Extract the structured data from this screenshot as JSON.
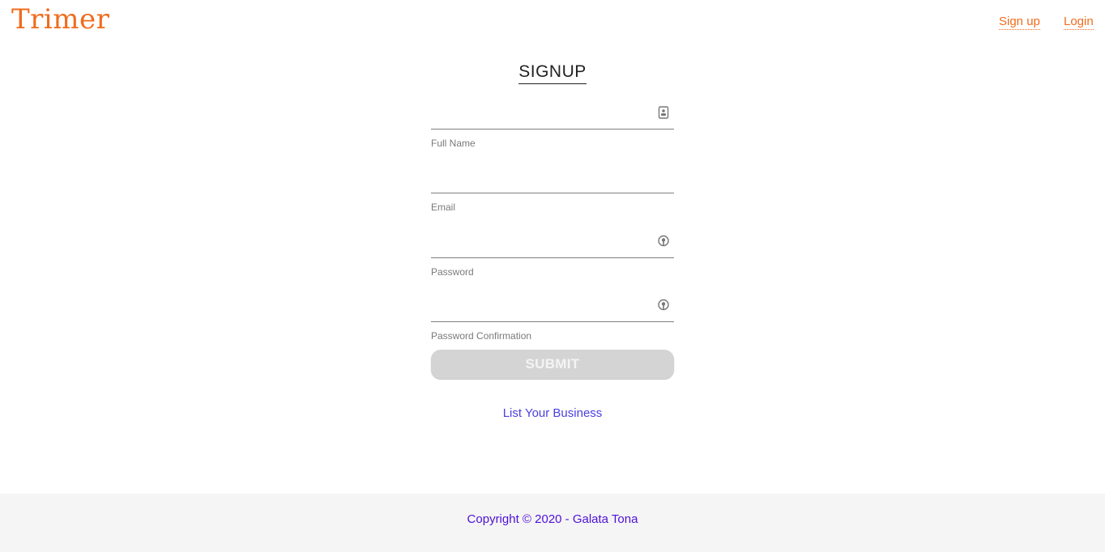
{
  "header": {
    "logo_text": "Trimer",
    "nav": {
      "signup": "Sign up",
      "login": "Login"
    }
  },
  "form": {
    "title": "SIGNUP",
    "fields": [
      {
        "label": "Full Name",
        "value": "",
        "icon": "contact-card-icon"
      },
      {
        "label": "Email",
        "value": "",
        "icon": null
      },
      {
        "label": "Password",
        "value": "",
        "icon": "lock-icon"
      },
      {
        "label": "Password Confirmation",
        "value": "",
        "icon": "lock-icon"
      }
    ],
    "submit_label": "SUBMIT",
    "list_business_link": "List Your Business"
  },
  "footer": {
    "copyright": "Copyright © 2020 - Galata Tona"
  },
  "colors": {
    "brand": "#ef6c1c",
    "link": "#4a3fe0",
    "footer_text": "#4e10d6",
    "submit_bg": "#d4d4d4"
  }
}
